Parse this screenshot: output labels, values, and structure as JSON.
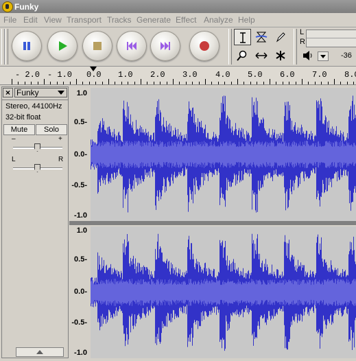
{
  "window": {
    "title": "Funky"
  },
  "menus": [
    "File",
    "Edit",
    "View",
    "Transport",
    "Tracks",
    "Generate",
    "Effect",
    "Analyze",
    "Help"
  ],
  "transport": [
    "pause",
    "play",
    "stop",
    "skip-start",
    "skip-end",
    "record"
  ],
  "tools": [
    "selection-tool",
    "envelope-tool",
    "draw-tool",
    "zoom-tool",
    "timeshift-tool",
    "multi-tool"
  ],
  "meter": {
    "left": "L",
    "right": "R",
    "db": "-36"
  },
  "ruler": {
    "labels": [
      "- 2.0",
      "- 1.0",
      "0.0",
      "1.0",
      "2.0",
      "3.0",
      "4.0",
      "5.0",
      "6.0",
      "7.0",
      "8.0"
    ]
  },
  "track": {
    "name": "Funky",
    "info1": "Stereo, 44100Hz",
    "info2": "32-bit float",
    "mute": "Mute",
    "solo": "Solo",
    "gain_minus": "–",
    "gain_plus": "+",
    "pan_left": "L",
    "pan_right": "R",
    "vlabels": [
      "1.0",
      "0.5-",
      "0.0-",
      "-0.5-",
      "-1.0"
    ]
  },
  "colors": {
    "wave": "#3232c8",
    "wave_bg": "#c8c8c8",
    "selection": "#b0b0b0"
  }
}
